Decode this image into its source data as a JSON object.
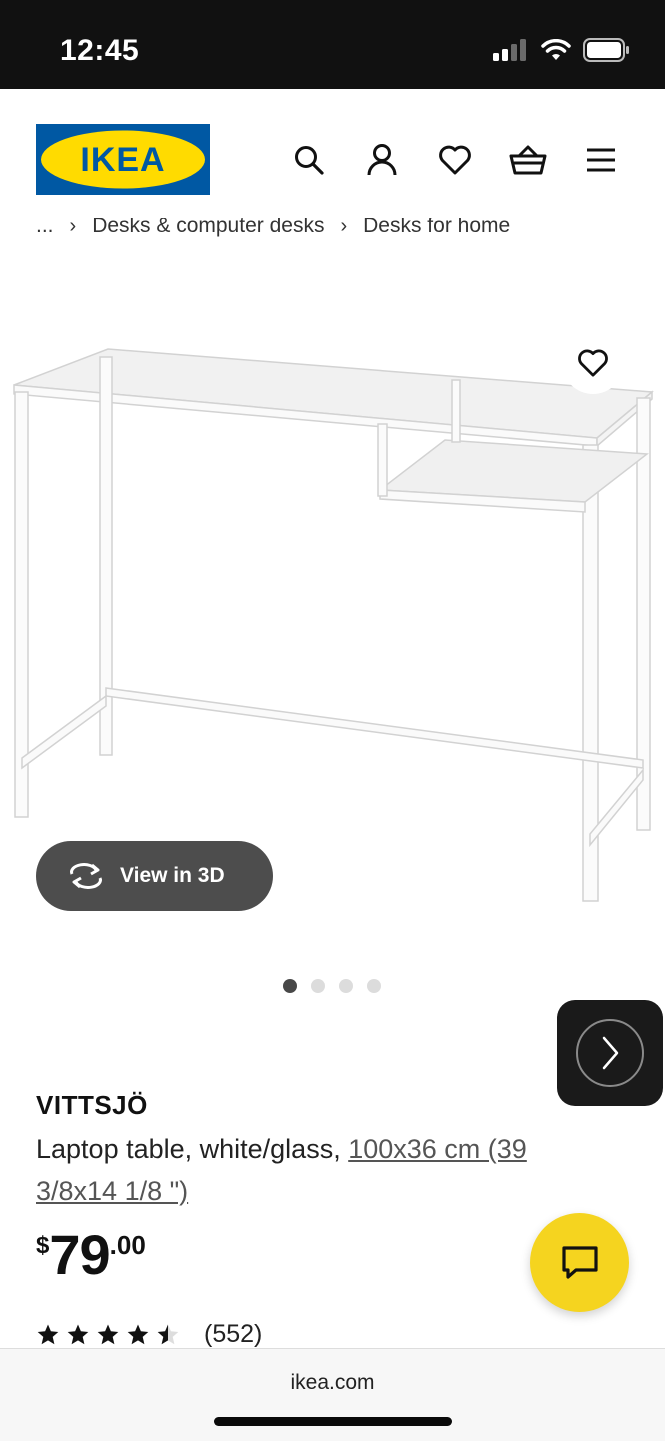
{
  "status_bar": {
    "time": "12:45",
    "icons": [
      "signal-icon",
      "wifi-icon",
      "battery-icon"
    ]
  },
  "header": {
    "logo_text": "IKEA",
    "icons": [
      "search-icon",
      "account-icon",
      "favorites-icon",
      "cart-icon",
      "menu-icon"
    ],
    "brand_colors": {
      "blue": "#0058a3",
      "yellow": "#ffdb00"
    }
  },
  "breadcrumb": {
    "items": [
      "...",
      "Desks & computer desks",
      "Desks for home"
    ]
  },
  "gallery": {
    "view3d_label": "View in 3D",
    "dots_total": 4,
    "active_dot": 1
  },
  "product": {
    "name": "VITTSJÖ",
    "description": "Laptop table, white/glass, ",
    "size_link": "100x36 cm (39 3/8x14 1/8 \")",
    "price": {
      "currency": "$",
      "integer": "79",
      "decimal": ".00"
    },
    "rating": {
      "value": 4.5,
      "max": 5,
      "count": "(552)"
    }
  },
  "chat": {
    "icon": "chat-icon",
    "color": "#f5d41f"
  },
  "browser": {
    "url": "ikea.com"
  }
}
